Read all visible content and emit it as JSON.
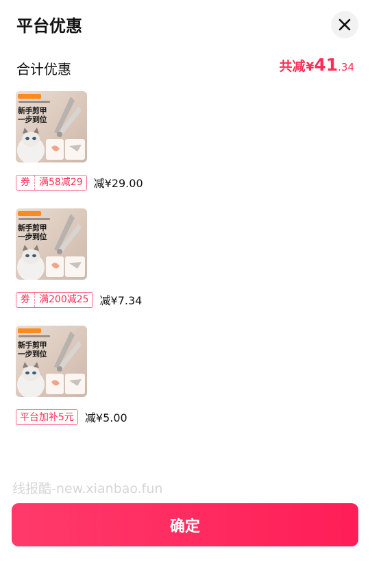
{
  "header": {
    "title": "平台优惠",
    "close_icon": "close-icon"
  },
  "summary": {
    "label": "合计优惠",
    "prefix": "共减",
    "currency": "¥",
    "integer": "41",
    "decimal": ".34"
  },
  "items": [
    {
      "image_headline_1": "新手剪甲",
      "image_headline_2": "一步到位",
      "badge_type": "coupon",
      "coupon_mark": "券",
      "badge_text": "满58减29",
      "amount": "减¥29.00"
    },
    {
      "image_headline_1": "新手剪甲",
      "image_headline_2": "一步到位",
      "badge_type": "coupon",
      "coupon_mark": "券",
      "badge_text": "满200减25",
      "amount": "减¥7.34"
    },
    {
      "image_headline_1": "新手剪甲",
      "image_headline_2": "一步到位",
      "badge_type": "platform",
      "coupon_mark": "",
      "badge_text": "平台加补5元",
      "amount": "减¥5.00"
    }
  ],
  "watermark": "线报酷-new.xianbao.fun",
  "confirm_label": "确定",
  "colors": {
    "accent": "#ff2d55",
    "button": "#ff2d5f"
  }
}
